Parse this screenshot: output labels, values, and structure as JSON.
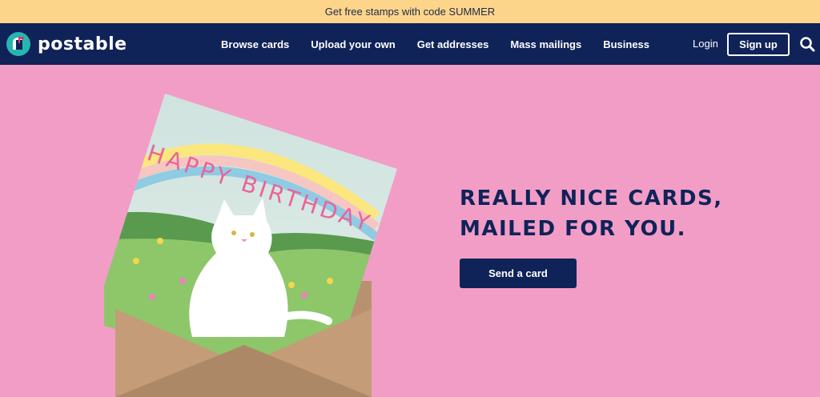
{
  "promo": {
    "text": "Get free stamps with code SUMMER"
  },
  "brand": {
    "name": "postable",
    "navy": "#0f2358",
    "pink": "#f29dc6",
    "yellow": "#fdd58a",
    "teal": "#27b5b0"
  },
  "nav": {
    "items": [
      {
        "label": "Browse cards"
      },
      {
        "label": "Upload your own"
      },
      {
        "label": "Get addresses"
      },
      {
        "label": "Mass mailings"
      },
      {
        "label": "Business"
      }
    ],
    "login": "Login",
    "signup": "Sign up",
    "search_icon": "search-icon"
  },
  "hero": {
    "headline_line1": "REALLY NICE CARDS,",
    "headline_line2": "MAILED FOR YOU.",
    "cta": "Send a card"
  },
  "card": {
    "text": "HAPPY BIRTHDAY"
  }
}
